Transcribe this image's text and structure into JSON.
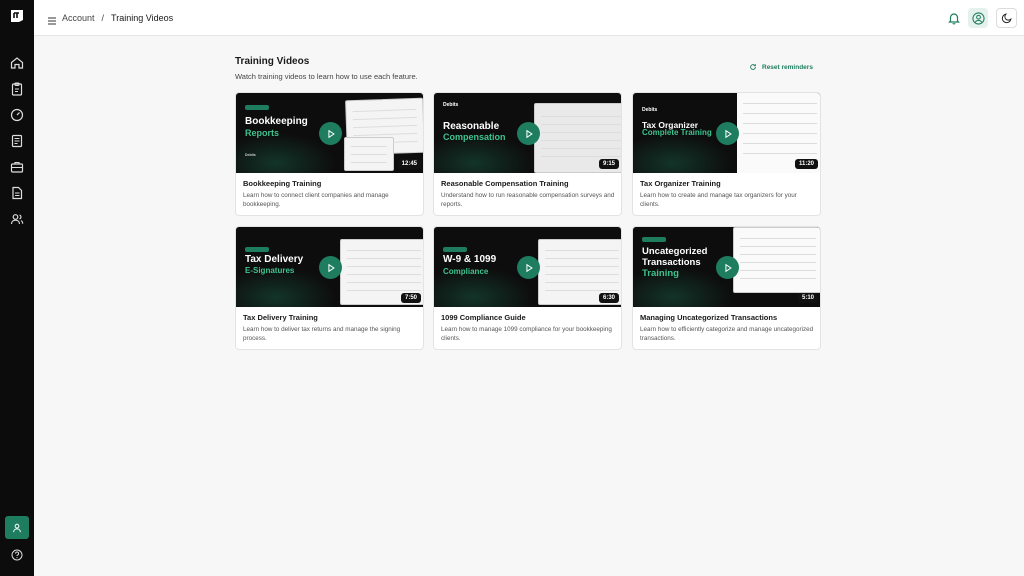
{
  "breadcrumb": {
    "parent": "Account",
    "separator": "/",
    "current": "Training Videos"
  },
  "page": {
    "title": "Training Videos",
    "subtitle": "Watch training videos to learn how to use each feature.",
    "reset_label": "Reset reminders"
  },
  "cards": [
    {
      "thumb_line1": "Bookkeeping",
      "thumb_line2": "Reports",
      "duration": "12:45",
      "title": "Bookkeeping Training",
      "desc": "Learn how to connect client companies and manage bookkeeping."
    },
    {
      "thumb_line1": "Reasonable",
      "thumb_line2": "Compensation",
      "duration": "9:15",
      "title": "Reasonable Compensation Training",
      "desc": "Understand how to run reasonable compensation surveys and reports."
    },
    {
      "thumb_line1": "Tax Organizer",
      "thumb_line2": "Complete Training",
      "duration": "11:20",
      "title": "Tax Organizer Training",
      "desc": "Learn how to create and manage tax organizers for your clients."
    },
    {
      "thumb_line1": "Tax Delivery",
      "thumb_line2": "E-Signatures",
      "duration": "7:50",
      "title": "Tax Delivery Training",
      "desc": "Learn how to deliver tax returns and manage the signing process."
    },
    {
      "thumb_line1": "W-9 & 1099",
      "thumb_line2": "Compliance",
      "duration": "6:30",
      "title": "1099 Compliance Guide",
      "desc": "Learn how to manage 1099 compliance for your bookkeeping clients."
    },
    {
      "thumb_line1": "Uncategorized",
      "thumb_line1b": "Transactions",
      "thumb_line2": "Training",
      "duration": "5:10",
      "title": "Managing Uncategorized Transactions",
      "desc": "Learn how to efficiently categorize and manage uncategorized transactions."
    }
  ],
  "thumb_brand": "Debits",
  "colors": {
    "accent": "#1e7d5f",
    "accent_light": "#3ec38f",
    "sidebar": "#0c0c0c"
  },
  "icons": {
    "sidebar": [
      "home-icon",
      "clipboard-icon",
      "gauge-icon",
      "document-icon",
      "briefcase-icon",
      "file-text-icon",
      "users-icon"
    ],
    "sidebar_bottom": [
      "user-icon",
      "help-icon"
    ],
    "header": [
      "menu-icon",
      "bell-icon",
      "user-circle-icon",
      "moon-icon"
    ]
  }
}
